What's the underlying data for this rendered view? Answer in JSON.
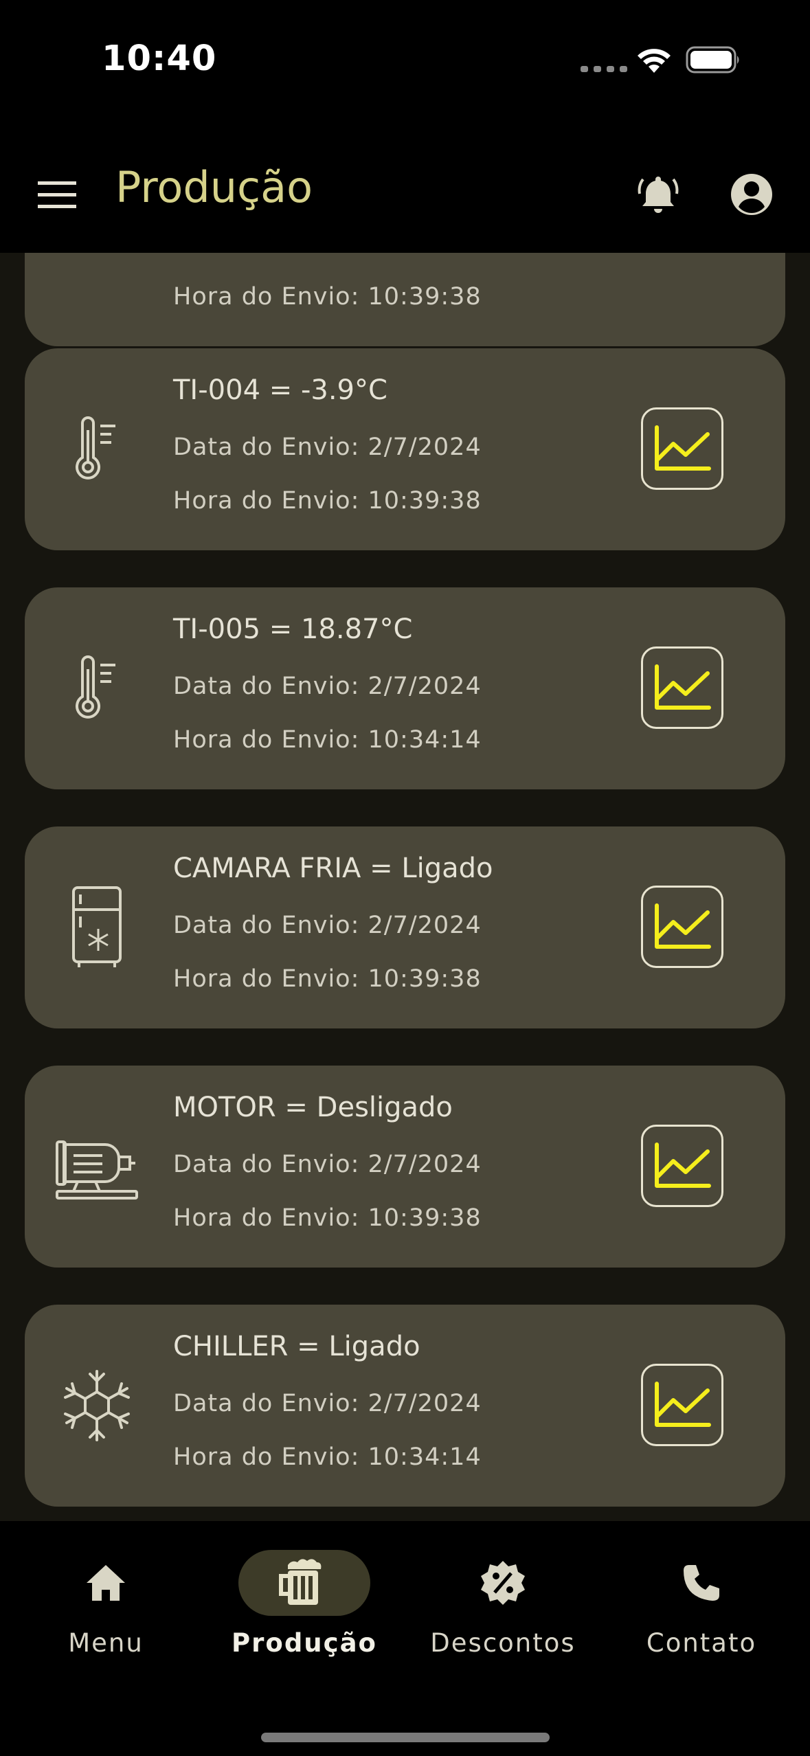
{
  "status_bar": {
    "time": "10:40"
  },
  "app_bar": {
    "title": "Produção",
    "menu_icon": "hamburger-menu-icon",
    "bell_icon": "bell-ringing-icon",
    "account_icon": "account-circle-icon"
  },
  "colors": {
    "title_accent": "#d6d28a",
    "chart_line": "#f5ee1c",
    "card_bg": "#4a4739"
  },
  "partial_card": {
    "time": "Hora do Envio: 10:39:38"
  },
  "cards": [
    {
      "icon": "thermometer-icon",
      "title": "TI-004 = -3.9°C",
      "date": "Data do Envio: 2/7/2024",
      "time": "Hora do Envio: 10:39:38"
    },
    {
      "icon": "thermometer-icon",
      "title": "TI-005 = 18.87°C",
      "date": "Data do Envio: 2/7/2024",
      "time": "Hora do Envio: 10:34:14"
    },
    {
      "icon": "cold-room-fridge-icon",
      "title": "CAMARA FRIA = Ligado",
      "date": "Data do Envio: 2/7/2024",
      "time": "Hora do Envio: 10:39:38"
    },
    {
      "icon": "electric-motor-icon",
      "title": "MOTOR = Desligado",
      "date": "Data do Envio: 2/7/2024",
      "time": "Hora do Envio: 10:39:38"
    },
    {
      "icon": "snowflake-chiller-icon",
      "title": "CHILLER = Ligado",
      "date": "Data do Envio: 2/7/2024",
      "time": "Hora do Envio: 10:34:14"
    }
  ],
  "bottom_nav": {
    "items": [
      {
        "label": "Menu",
        "icon": "home-icon",
        "active": false
      },
      {
        "label": "Produção",
        "icon": "beer-mug-icon",
        "active": true
      },
      {
        "label": "Descontos",
        "icon": "discount-badge-icon",
        "active": false
      },
      {
        "label": "Contato",
        "icon": "phone-icon",
        "active": false
      }
    ]
  }
}
